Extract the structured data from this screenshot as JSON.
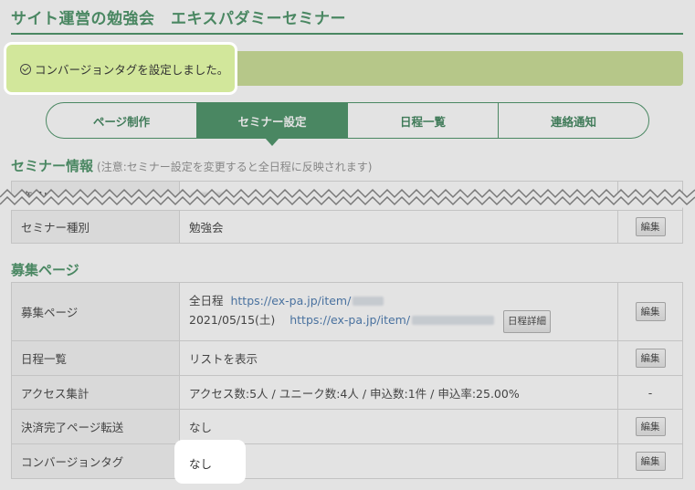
{
  "page": {
    "title": "サイト運営の勉強会　エキスパダミーセミナー"
  },
  "alert": {
    "message": "コンバージョンタグを設定しました。"
  },
  "tabs": [
    {
      "label": "ページ制作",
      "active": false
    },
    {
      "label": "セミナー設定",
      "active": true
    },
    {
      "label": "日程一覧",
      "active": false
    },
    {
      "label": "連絡通知",
      "active": false
    }
  ],
  "seminar_info": {
    "heading": "セミナー情報",
    "note": "(注意:セミナー設定を変更すると全日程に反映されます)",
    "rows": [
      {
        "label": "商品ID",
        "value": "",
        "action": "-"
      },
      {
        "label": "セミナー種別",
        "value": "勉強会",
        "action": "編集"
      }
    ]
  },
  "recruit": {
    "heading": "募集ページ",
    "rows": {
      "page": {
        "label": "募集ページ",
        "line1_prefix": "全日程",
        "line1_url": "https://ex-pa.jp/item/",
        "line2_date": "2021/05/15(土)",
        "line2_url": "https://ex-pa.jp/item/",
        "detail_button": "日程詳細",
        "action": "編集"
      },
      "schedule": {
        "label": "日程一覧",
        "value": "リストを表示",
        "action": "編集"
      },
      "access": {
        "label": "アクセス集計",
        "value": "アクセス数:5人 / ユニーク数:4人 / 申込数:1件 / 申込率:25.00%",
        "action": "-"
      },
      "redirect": {
        "label": "決済完了ページ転送",
        "value": "なし",
        "action": "編集"
      },
      "conversion": {
        "label": "コンバージョンタグ",
        "value": "なし",
        "action": "編集"
      }
    }
  },
  "colors": {
    "brand_green": "#3b8a5a",
    "alert_bg": "#c6dc8c",
    "link": "#3a6ea8"
  }
}
